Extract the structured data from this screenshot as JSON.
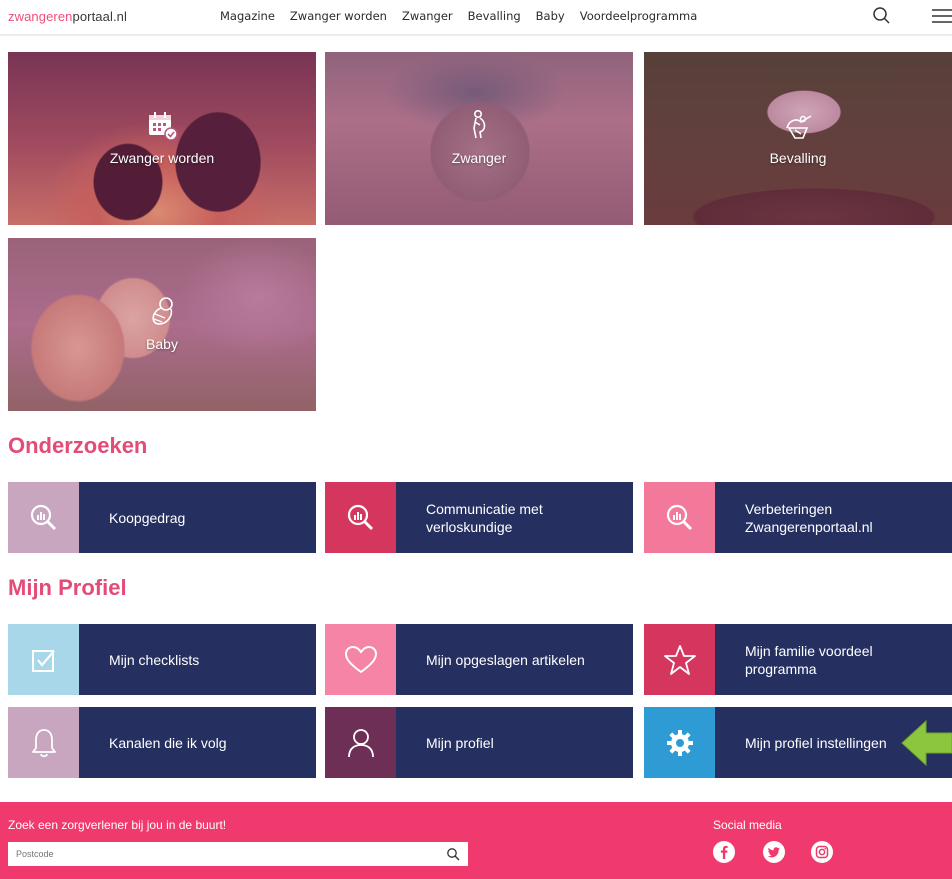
{
  "header": {
    "logo_part1": "zwangeren",
    "logo_part2": "portaal.nl",
    "nav": [
      "Magazine",
      "Zwanger worden",
      "Zwanger",
      "Bevalling",
      "Baby",
      "Voordeelprogramma"
    ],
    "search_icon": "search-icon",
    "menu_icon": "hamburger-menu-icon"
  },
  "categories": [
    {
      "label": "Zwanger worden",
      "icon": "calendar-check-icon"
    },
    {
      "label": "Zwanger",
      "icon": "pregnant-woman-icon"
    },
    {
      "label": "Bevalling",
      "icon": "stork-icon"
    },
    {
      "label": "Baby",
      "icon": "baby-swaddle-icon"
    }
  ],
  "onderzoeken": {
    "heading": "Onderzoeken",
    "items": [
      {
        "label": "Koopgedrag",
        "icon": "magnifier-chart-icon",
        "color": "#c9a6bf"
      },
      {
        "label": "Communicatie met verloskundige",
        "icon": "magnifier-chart-icon",
        "color": "#d5365e"
      },
      {
        "label": "Verbeteringen Zwangerenportaal.nl",
        "icon": "magnifier-chart-icon",
        "color": "#f3799a"
      }
    ]
  },
  "profiel": {
    "heading": "Mijn Profiel",
    "items": [
      {
        "label": "Mijn checklists",
        "icon": "checkbox-icon",
        "color": "#a8d7ea"
      },
      {
        "label": "Mijn opgeslagen artikelen",
        "icon": "heart-icon",
        "color": "#f584a6"
      },
      {
        "label": "Mijn familie voordeel programma",
        "icon": "star-icon",
        "color": "#d5365e"
      },
      {
        "label": "Kanalen die ik volg",
        "icon": "bell-icon",
        "color": "#c9a6bf"
      },
      {
        "label": "Mijn profiel",
        "icon": "user-icon",
        "color": "#6e2f57"
      },
      {
        "label": "Mijn profiel instellingen",
        "icon": "gear-icon",
        "color": "#2e9bd5"
      }
    ]
  },
  "footer": {
    "title": "Zoek een zorgverlener bij jou in de buurt!",
    "input_placeholder": "Postcode",
    "social_title": "Social media",
    "social": [
      "facebook-icon",
      "twitter-icon",
      "instagram-icon"
    ]
  },
  "colors": {
    "brand_pink": "#ee4f7c",
    "navy": "#253061",
    "footer_pink": "#f03a6e",
    "arrow_green": "#8cc63f"
  }
}
